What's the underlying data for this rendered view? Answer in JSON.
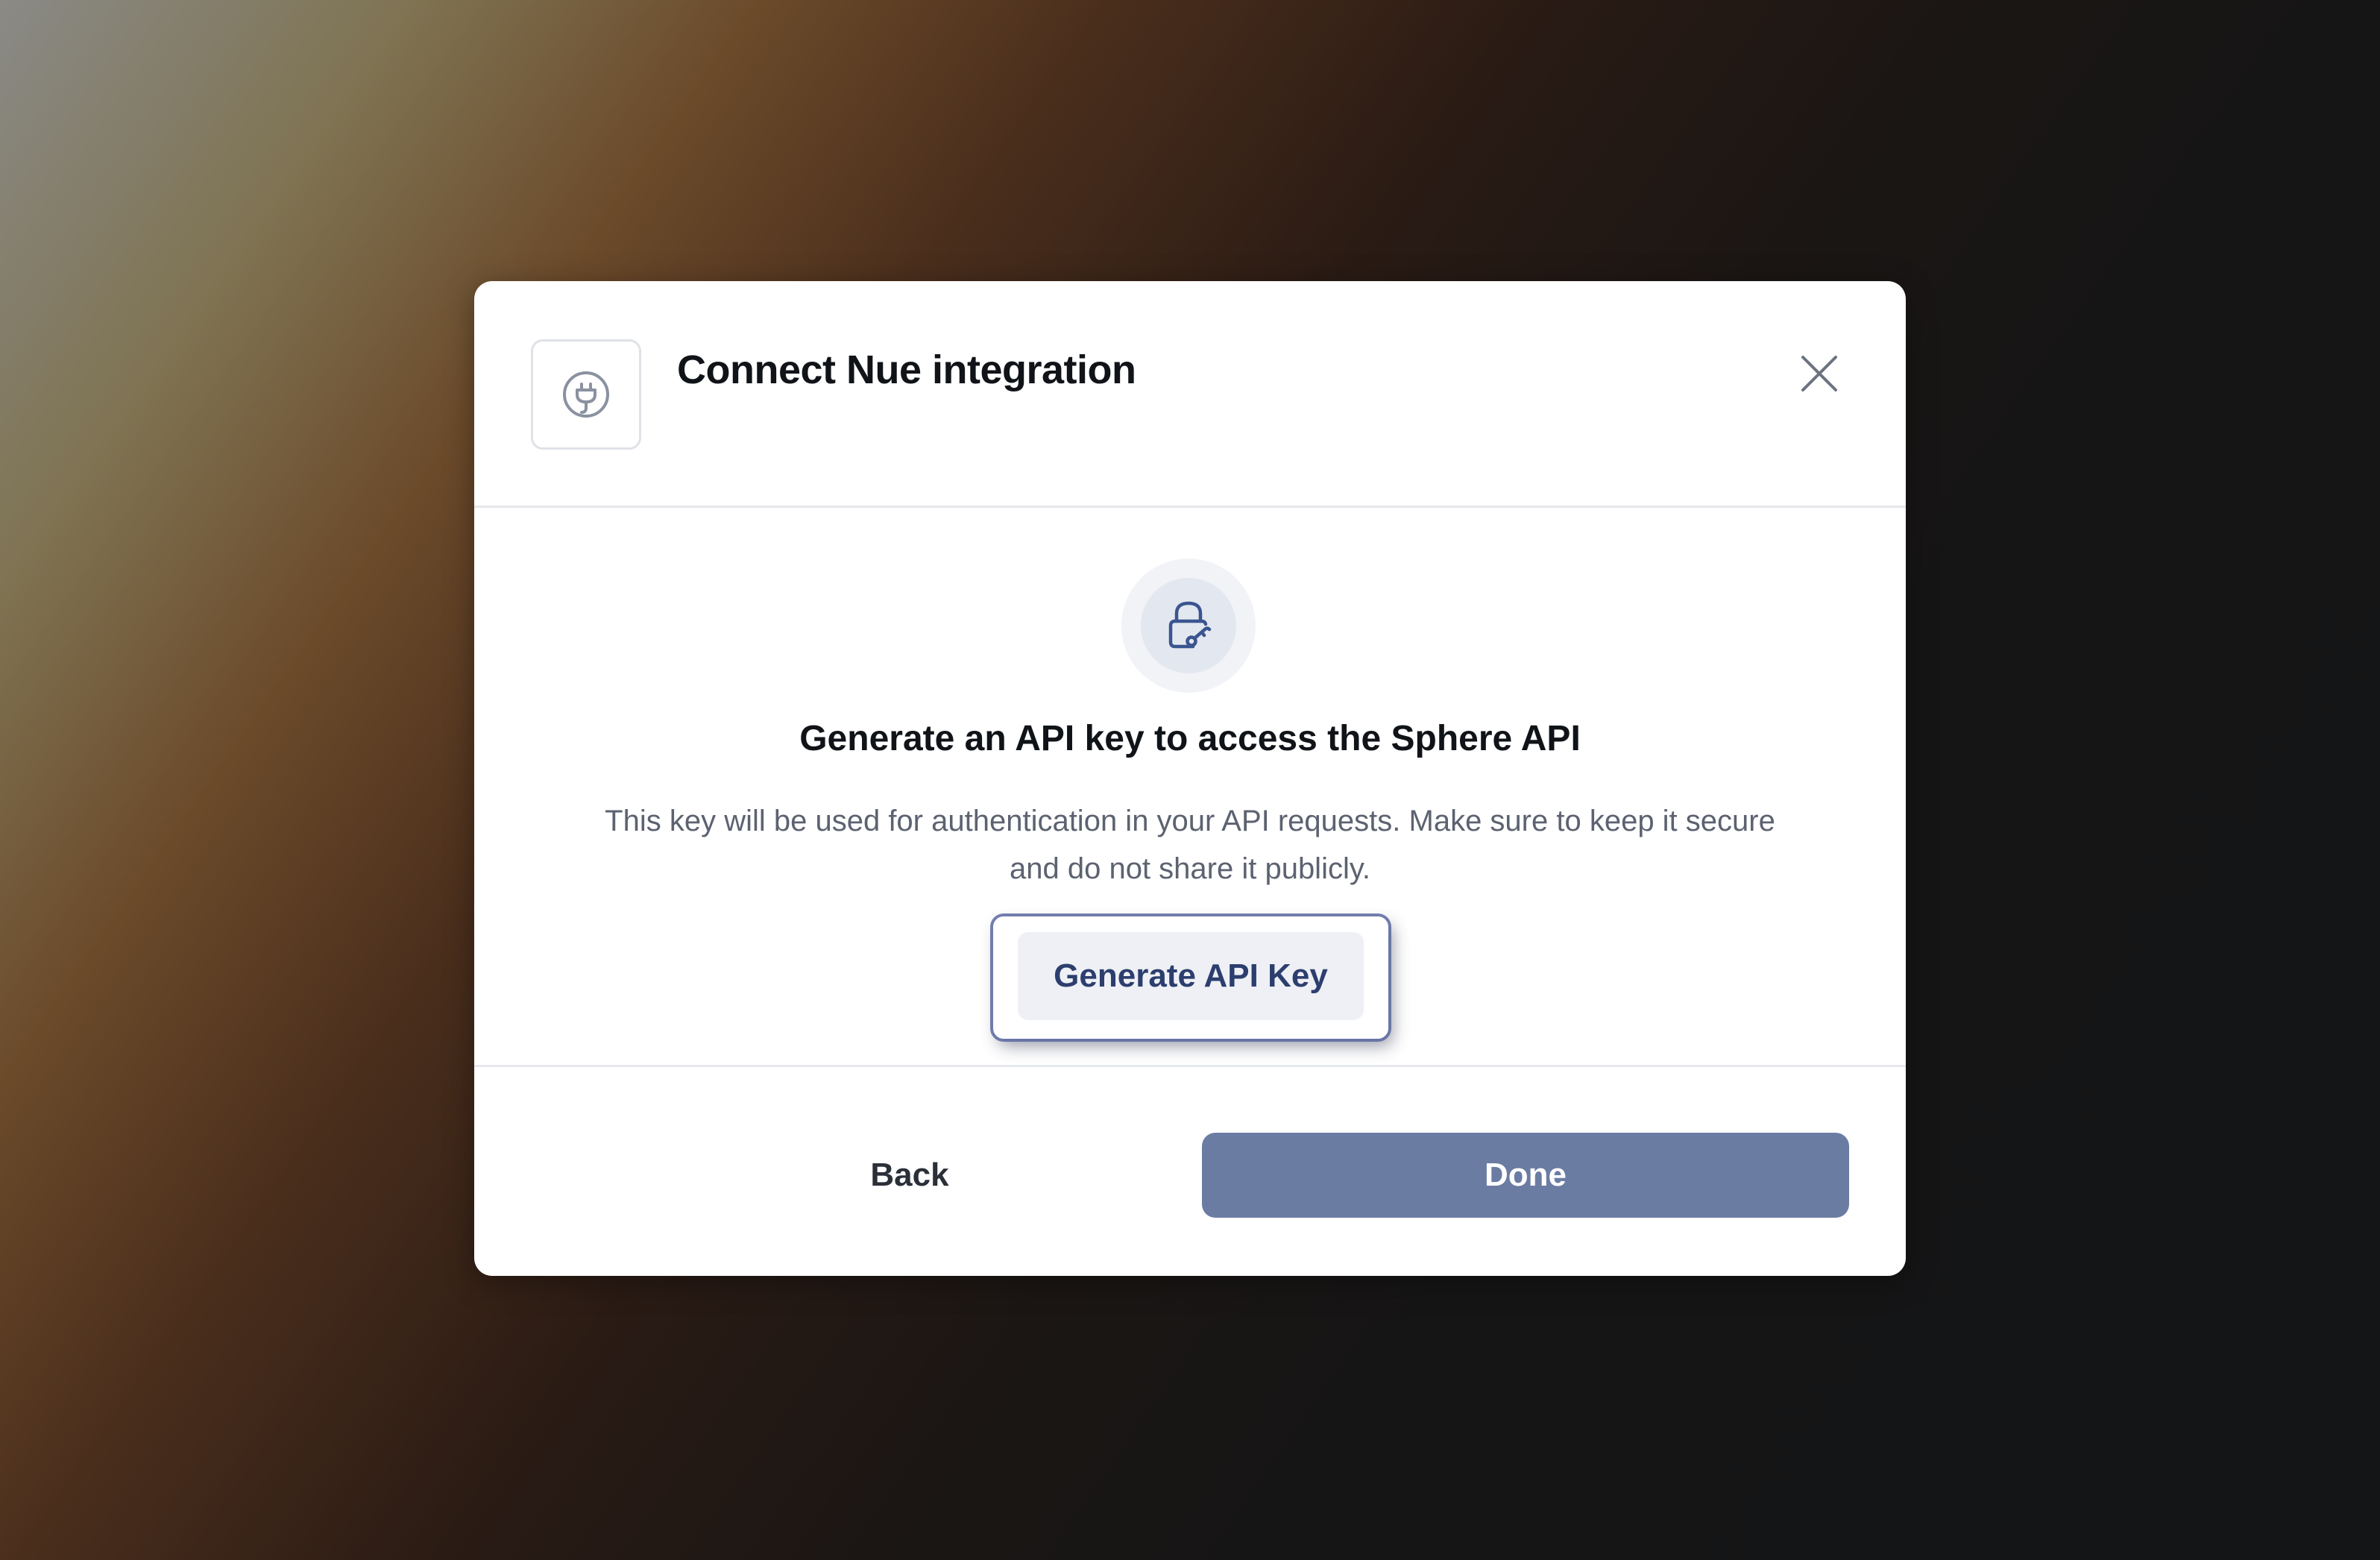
{
  "dialog": {
    "title": "Connect Nue integration",
    "header_icon": "plug-icon",
    "close_icon": "close-icon"
  },
  "body": {
    "icon": "lock-key-icon",
    "heading": "Generate an API key to access the Sphere API",
    "description": "This key will be used for authentication in your API requests. Make sure to keep it secure and do not share it publicly.",
    "generate_button_label": "Generate API Key"
  },
  "footer": {
    "back_label": "Back",
    "done_label": "Done"
  },
  "colors": {
    "primary": "#6b7ca3",
    "accent_text": "#2c3e6e",
    "icon_stroke": "#3a5590"
  }
}
